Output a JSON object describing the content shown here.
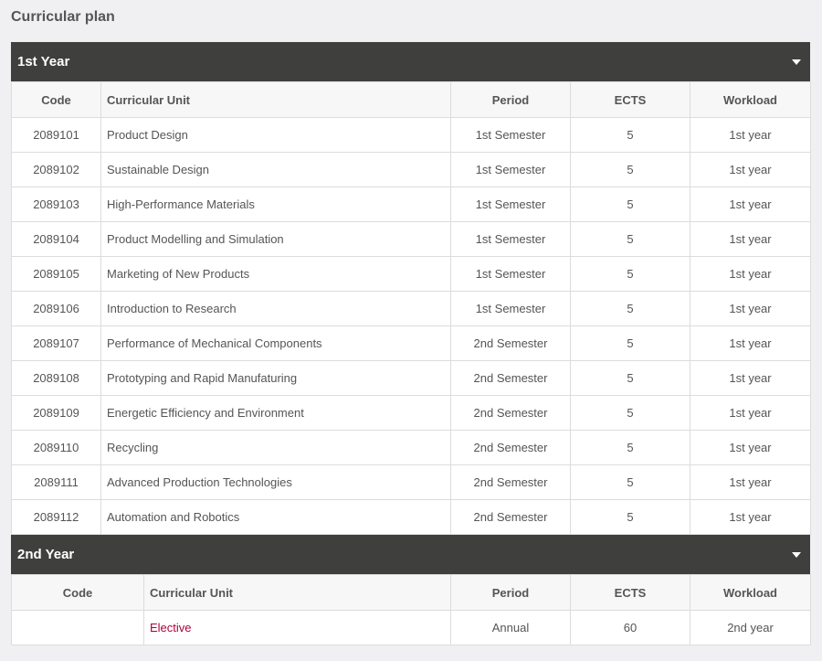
{
  "page": {
    "title": "Curricular plan"
  },
  "years": [
    {
      "label": "1st Year",
      "columns": {
        "code": "Code",
        "unit": "Curricular Unit",
        "period": "Period",
        "ects": "ECTS",
        "workload": "Workload"
      },
      "rows": [
        {
          "code": "2089101",
          "unit": "Product Design",
          "period": "1st Semester",
          "ects": "5",
          "workload": "1st year"
        },
        {
          "code": "2089102",
          "unit": "Sustainable Design",
          "period": "1st Semester",
          "ects": "5",
          "workload": "1st year"
        },
        {
          "code": "2089103",
          "unit": "High-Performance Materials",
          "period": "1st Semester",
          "ects": "5",
          "workload": "1st year"
        },
        {
          "code": "2089104",
          "unit": "Product Modelling and Simulation",
          "period": "1st Semester",
          "ects": "5",
          "workload": "1st year"
        },
        {
          "code": "2089105",
          "unit": "Marketing of New Products",
          "period": "1st Semester",
          "ects": "5",
          "workload": "1st year"
        },
        {
          "code": "2089106",
          "unit": "Introduction to Research",
          "period": "1st Semester",
          "ects": "5",
          "workload": "1st year"
        },
        {
          "code": "2089107",
          "unit": "Performance of Mechanical Components",
          "period": "2nd Semester",
          "ects": "5",
          "workload": "1st year"
        },
        {
          "code": "2089108",
          "unit": "Prototyping and Rapid Manufaturing",
          "period": "2nd Semester",
          "ects": "5",
          "workload": "1st year"
        },
        {
          "code": "2089109",
          "unit": "Energetic Efficiency and Environment",
          "period": "2nd Semester",
          "ects": "5",
          "workload": "1st year"
        },
        {
          "code": "2089110",
          "unit": "Recycling",
          "period": "2nd Semester",
          "ects": "5",
          "workload": "1st year"
        },
        {
          "code": "2089111",
          "unit": "Advanced Production Technologies",
          "period": "2nd Semester",
          "ects": "5",
          "workload": "1st year"
        },
        {
          "code": "2089112",
          "unit": "Automation and Robotics",
          "period": "2nd Semester",
          "ects": "5",
          "workload": "1st year"
        }
      ]
    },
    {
      "label": "2nd Year",
      "columns": {
        "code": "Code",
        "unit": "Curricular Unit",
        "period": "Period",
        "ects": "ECTS",
        "workload": "Workload"
      },
      "rows": [
        {
          "code": "",
          "unit": "Elective",
          "period": "Annual",
          "ects": "60",
          "workload": "2nd year",
          "link": true
        }
      ]
    }
  ],
  "icons": {
    "collapse": "caret-down-icon"
  },
  "colors": {
    "header_bg": "#3f3f3d",
    "link": "#b0003a",
    "page_bg": "#f0f0f2"
  }
}
